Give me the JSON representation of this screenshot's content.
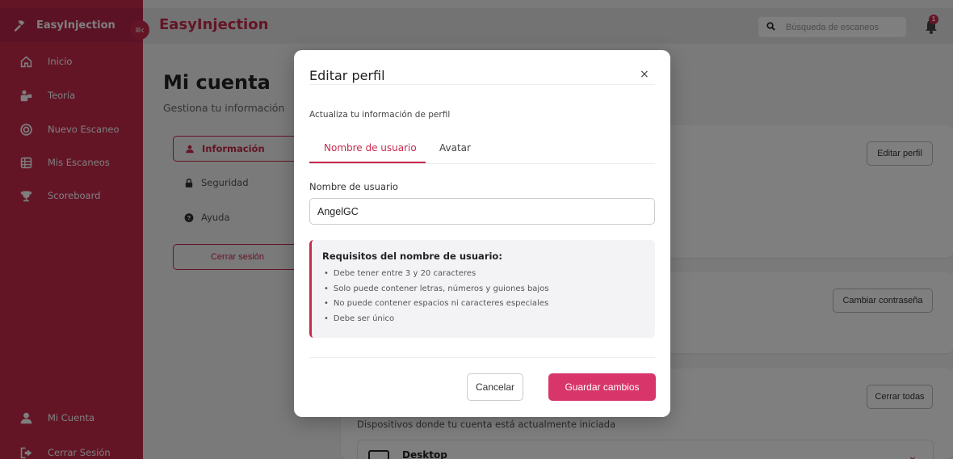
{
  "colors": {
    "brand": "#c72a4d",
    "save_button": "#d8366a",
    "overlay": "rgba(0,0,0,0.5)"
  },
  "sidebar": {
    "brand": "EasyInjection",
    "items": [
      {
        "label": "Inicio",
        "icon": "home-icon"
      },
      {
        "label": "Teoría",
        "icon": "teacher-icon"
      },
      {
        "label": "Nuevo Escaneo",
        "icon": "target-icon"
      },
      {
        "label": "Mis Escaneos",
        "icon": "table-icon"
      },
      {
        "label": "Scoreboard",
        "icon": "trophy-icon"
      }
    ],
    "bottom": [
      {
        "label": "Mi Cuenta",
        "icon": "user-icon"
      },
      {
        "label": "Cerrar Sesión",
        "icon": "logout-icon"
      }
    ]
  },
  "topbar": {
    "title": "EasyInjection",
    "search_placeholder": "Búsqueda de escaneos",
    "notification_count": "1"
  },
  "account": {
    "title": "Mi cuenta",
    "subtitle": "Gestiona tu información",
    "nav": [
      {
        "label": "Información",
        "icon": "user-icon"
      },
      {
        "label": "Seguridad",
        "icon": "lock-icon"
      },
      {
        "label": "Ayuda",
        "icon": "help-icon"
      }
    ],
    "logout": "Cerrar sesión",
    "edit_profile": "Editar perfil",
    "change_password": "Cambiar contraseña",
    "close_all": "Cerrar todas",
    "sessions_sub": "Dispositivos donde tu cuenta está actualmente iniciada",
    "device_name": "Desktop"
  },
  "modal": {
    "title": "Editar perfil",
    "close": "×",
    "description": "Actualiza tu información de perfil",
    "tabs": [
      "Nombre de usuario",
      "Avatar"
    ],
    "field_label": "Nombre de usuario",
    "field_value": "AngelGC",
    "requirements": {
      "title": "Requisitos del nombre de usuario:",
      "items": [
        "Debe tener entre 3 y 20 caracteres",
        "Solo puede contener letras, números y guiones bajos",
        "No puede contener espacios ni caracteres especiales",
        "Debe ser único"
      ]
    },
    "cancel": "Cancelar",
    "save": "Guardar cambios"
  }
}
